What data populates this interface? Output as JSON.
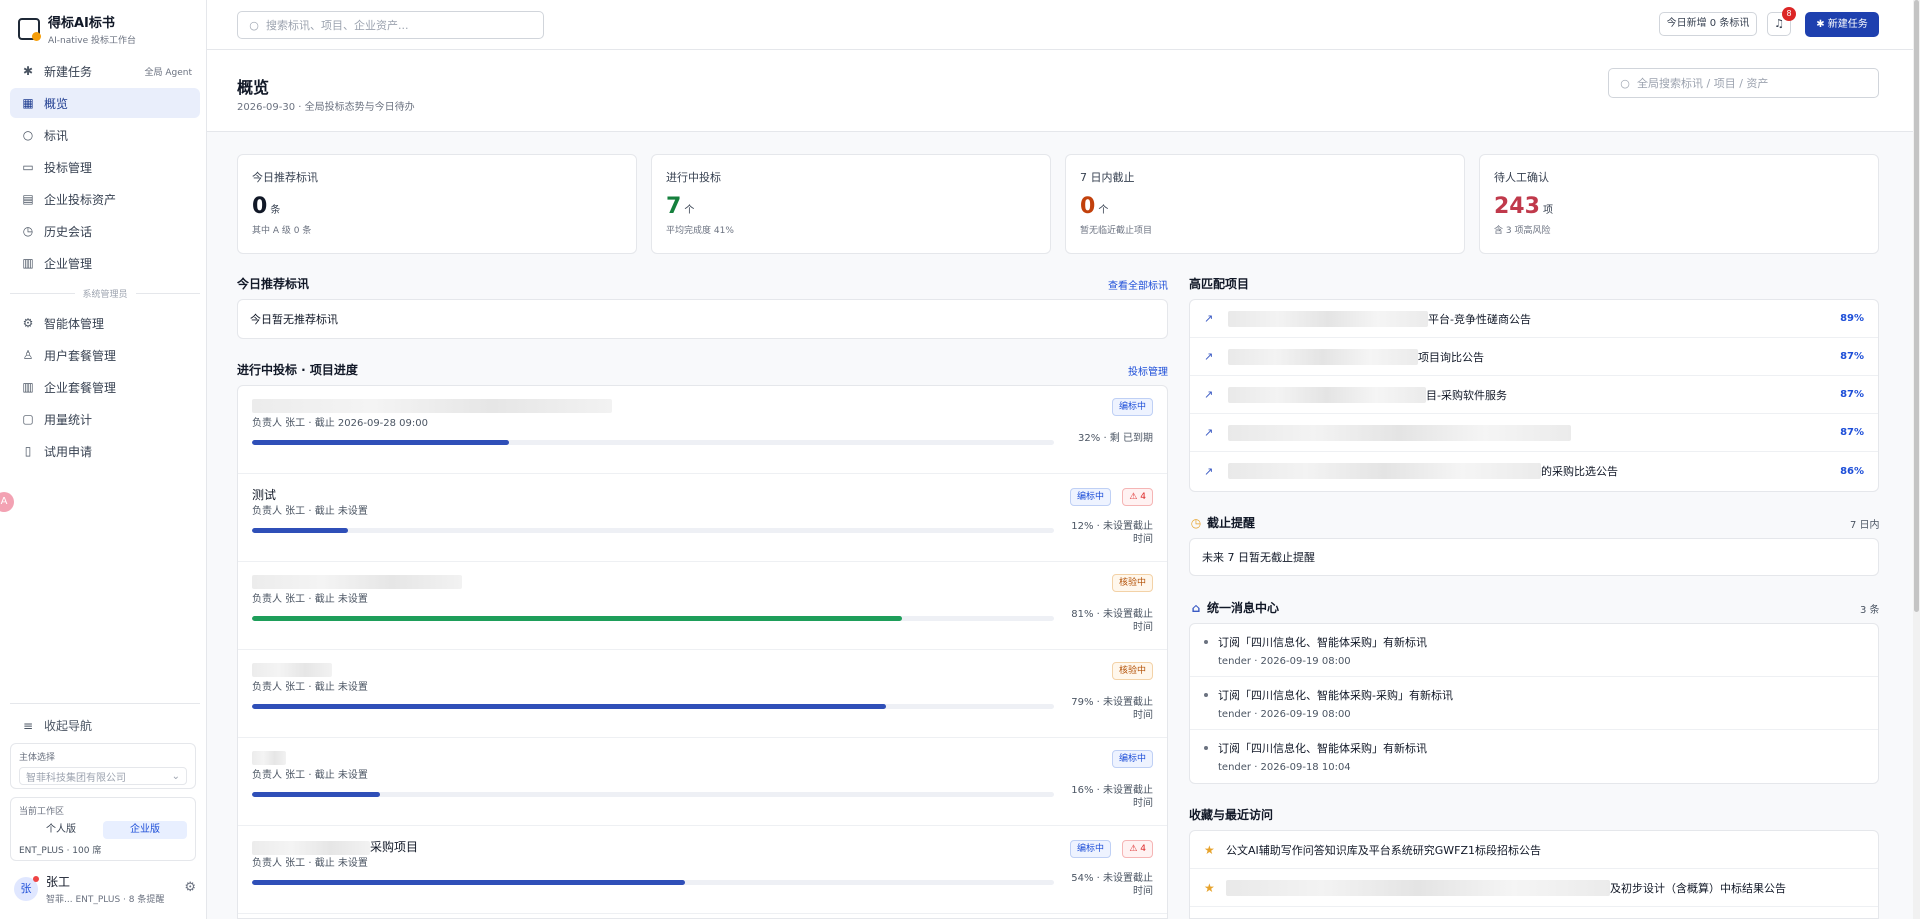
{
  "brand": {
    "title": "得标AI标书",
    "subtitle": "AI-native 投标工作台"
  },
  "nav": {
    "new_task": {
      "label": "新建任务",
      "tag": "全局 Agent"
    },
    "items": [
      {
        "label": "概览",
        "icon": "grid-icon"
      },
      {
        "label": "标讯",
        "icon": "search-icon"
      },
      {
        "label": "投标管理",
        "icon": "folder-icon"
      },
      {
        "label": "企业投标资产",
        "icon": "book-icon"
      },
      {
        "label": "历史会话",
        "icon": "clock-icon"
      },
      {
        "label": "企业管理",
        "icon": "building-icon"
      }
    ],
    "admin_section": "系统管理员",
    "admin_items": [
      {
        "label": "智能体管理",
        "icon": "gear-icon"
      },
      {
        "label": "用户套餐管理",
        "icon": "user-icon"
      },
      {
        "label": "企业套餐管理",
        "icon": "building-icon"
      },
      {
        "label": "用量统计",
        "icon": "monitor-icon"
      },
      {
        "label": "试用申请",
        "icon": "document-icon"
      }
    ],
    "collapse": "收起导航"
  },
  "subject": {
    "label": "主体选择",
    "value": "智菲科技集团有限公司"
  },
  "workspace": {
    "label": "当前工作区",
    "options": [
      "个人版",
      "企业版"
    ],
    "active": "企业版",
    "plan": "ENT_PLUS · 100 席"
  },
  "user": {
    "avatar": "张",
    "name": "张工",
    "meta": "智菲...    ENT_PLUS · 8 条提醒"
  },
  "float_badge": "A",
  "topbar": {
    "search_placeholder": "搜索标讯、项目、企业资产...",
    "today_new": "今日新增 0 条标讯",
    "bell_count": "8",
    "new_task": "新建任务"
  },
  "header": {
    "title": "概览",
    "subtitle": "2026-09-30 · 全局投标态势与今日待办",
    "search_placeholder": "全局搜索标讯 / 项目 / 资产"
  },
  "stats": [
    {
      "label": "今日推荐标讯",
      "value": "0",
      "unit": "条",
      "note": "其中 A 级 0 条",
      "color": "#111827"
    },
    {
      "label": "进行中投标",
      "value": "7",
      "unit": "个",
      "note": "平均完成度 41%",
      "color": "#15803d"
    },
    {
      "label": "7 日内截止",
      "value": "0",
      "unit": "个",
      "note": "暂无临近截止项目",
      "color": "#c2410c"
    },
    {
      "label": "待人工确认",
      "value": "243",
      "unit": "项",
      "note": "含 3 项高风险",
      "color": "#c0394b"
    }
  ],
  "recommend": {
    "title": "今日推荐标讯",
    "link": "查看全部标讯",
    "empty": "今日暂无推荐标讯"
  },
  "progress": {
    "title": "进行中投标 · 项目进度",
    "link": "投标管理",
    "items": [
      {
        "name": "",
        "meta": "负责人 张工 · 截止 2026-09-28 09:00",
        "percent": 32,
        "pct_text": "32% · 剩 已到期",
        "status": "编标中",
        "risk": ""
      },
      {
        "name": "测试",
        "meta": "负责人 张工 · 截止 未设置",
        "percent": 12,
        "pct_text": "12% · 未设置截止时间",
        "status": "编标中",
        "risk": "4"
      },
      {
        "name": "",
        "meta": "负责人 张工 · 截止 未设置",
        "percent": 81,
        "pct_text": "81% · 未设置截止时间",
        "status": "核验中",
        "risk": ""
      },
      {
        "name": "",
        "meta": "负责人 张工 · 截止 未设置",
        "percent": 79,
        "pct_text": "79% · 未设置截止时间",
        "status": "核验中",
        "risk": ""
      },
      {
        "name": "",
        "meta": "负责人 张工 · 截止 未设置",
        "percent": 16,
        "pct_text": "16% · 未设置截止时间",
        "status": "编标中",
        "risk": ""
      },
      {
        "name": "采购项目",
        "meta": "负责人 张工 · 截止 未设置",
        "percent": 54,
        "pct_text": "54% · 未设置截止时间",
        "status": "编标中",
        "risk": "4"
      }
    ]
  },
  "high_match": {
    "title": "高匹配项目",
    "items": [
      {
        "tail": "平台-竞争性磋商公告",
        "pct": "89%"
      },
      {
        "tail": "项目询比公告",
        "pct": "87%"
      },
      {
        "tail": "目-采购软件服务",
        "pct": "87%"
      },
      {
        "tail": "",
        "pct": "87%"
      },
      {
        "tail": "的采购比选公告",
        "pct": "86%"
      }
    ]
  },
  "deadline": {
    "title": "截止提醒",
    "range": "7 日内",
    "empty": "未来 7 日暂无截止提醒"
  },
  "messages": {
    "title": "统一消息中心",
    "count": "3 条",
    "items": [
      {
        "title": "订阅「四川信息化、智能体采购」有新标讯",
        "meta": "tender · 2026-09-19 08:00"
      },
      {
        "title": "订阅「四川信息化、智能体采购-采购」有新标讯",
        "meta": "tender · 2026-09-19 08:00"
      },
      {
        "title": "订阅「四川信息化、智能体采购」有新标讯",
        "meta": "tender · 2026-09-18 10:04"
      }
    ]
  },
  "favorites": {
    "title": "收藏与最近访问",
    "items": [
      {
        "text": "公文AI辅助写作问答知识库及平台系统研究GWFZ1标段招标公告"
      },
      {
        "text": "及初步设计（含概算）中标结果公告"
      }
    ]
  }
}
